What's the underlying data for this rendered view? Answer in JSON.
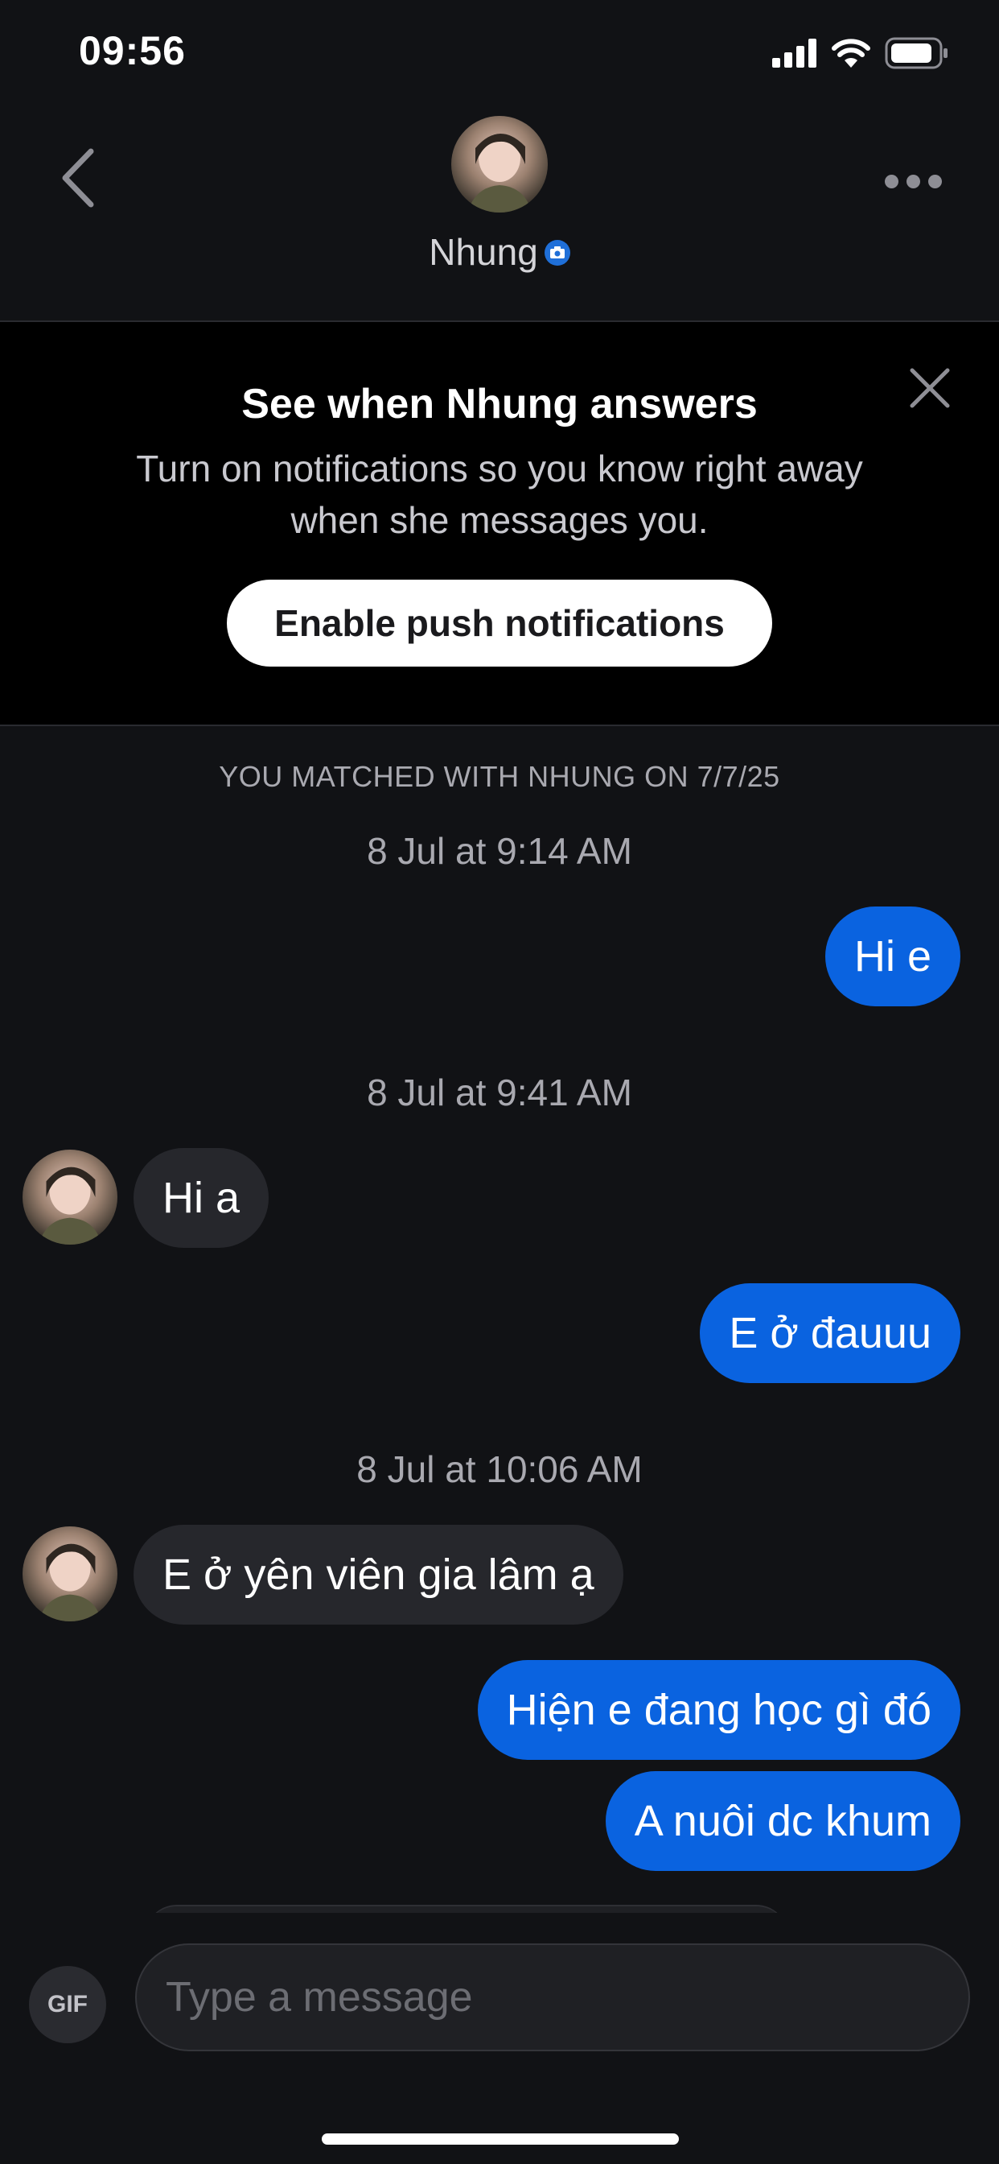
{
  "status_bar": {
    "time": "09:56",
    "icons": [
      "cellular-signal-icon",
      "wifi-icon",
      "battery-icon"
    ]
  },
  "header": {
    "back_icon": "chevron-left-icon",
    "name": "Nhung",
    "badge_icon": "camera-verified-icon",
    "more_icon": "more-horizontal-icon"
  },
  "notification_banner": {
    "title": "See when Nhung answers",
    "body": "Turn on notifications so you know right away when she messages you.",
    "button_label": "Enable push notifications",
    "close_icon": "close-icon"
  },
  "chat": {
    "match_label": "YOU MATCHED WITH NHUNG ON 7/7/25",
    "timestamps": [
      "8 Jul at 9:14 AM",
      "8 Jul at 9:41 AM",
      "8 Jul at 10:06 AM"
    ],
    "messages": [
      {
        "direction": "out",
        "text": "Hi e"
      },
      {
        "direction": "in",
        "text": "Hi a"
      },
      {
        "direction": "out",
        "text": "E ở đauuu"
      },
      {
        "direction": "in",
        "text": "E ở yên viên gia lâm ạ"
      },
      {
        "direction": "out",
        "text": "Hiện e đang học gì đó"
      },
      {
        "direction": "out",
        "text": "A nuôi dc khum"
      }
    ]
  },
  "composer": {
    "gif_label": "GIF",
    "placeholder": "Type a message",
    "value": ""
  },
  "colors": {
    "background": "#111215",
    "outgoing_bubble": "#0a63e0",
    "incoming_bubble": "#26272c",
    "banner_background": "#000000",
    "verified_badge": "#1f6fd8"
  }
}
